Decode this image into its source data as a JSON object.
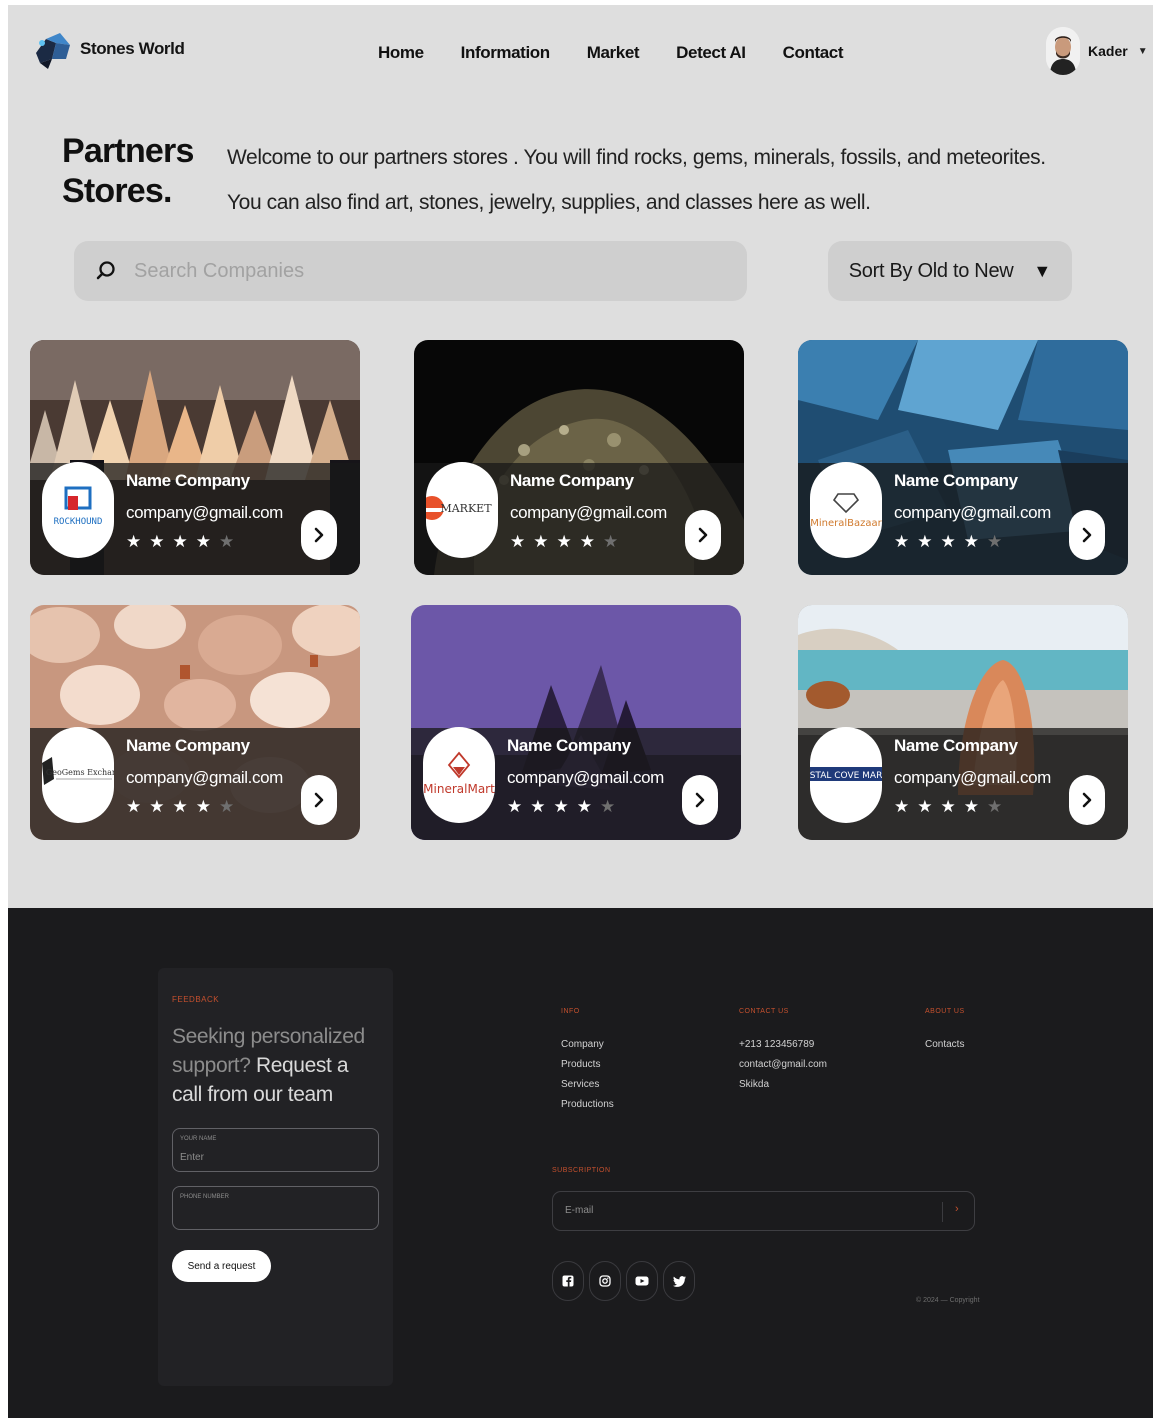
{
  "header": {
    "brand": "Stones World",
    "nav": [
      "Home",
      "Information",
      "Market",
      "Detect AI",
      "Contact"
    ],
    "user_name": "Kader"
  },
  "hero": {
    "title_line1": "Partners",
    "title_line2": "Stores.",
    "text": "Welcome to our partners stores . You will find rocks, gems, minerals, fossils, and meteorites. You can also find art, stones, jewelry, supplies, and classes here as well."
  },
  "search": {
    "placeholder": "Search Companies"
  },
  "sort": {
    "label": "Sort By Old to New"
  },
  "cards": [
    {
      "name": "Name Company",
      "email": "company@gmail.com",
      "rating": 4,
      "logo_text": "ROCKHOUND"
    },
    {
      "name": "Name Company",
      "email": "company@gmail.com",
      "rating": 4,
      "logo_text": "MARKET"
    },
    {
      "name": "Name Company",
      "email": "company@gmail.com",
      "rating": 4,
      "logo_text": "MineralBazaar"
    },
    {
      "name": "Name Company",
      "email": "company@gmail.com",
      "rating": 4,
      "logo_text": "GeoGems Exchang"
    },
    {
      "name": "Name Company",
      "email": "company@gmail.com",
      "rating": 4,
      "logo_text": "MineralMart"
    },
    {
      "name": "Name Company",
      "email": "company@gmail.com",
      "rating": 4,
      "logo_text": "STAL COVE MAR"
    }
  ],
  "footer": {
    "feedback": {
      "tag": "FEEDBACK",
      "headline_muted": "Seeking personalized support?",
      "headline_strong": "Request a call from our team",
      "name_label": "YOUR NAME",
      "name_placeholder": "Enter",
      "phone_label": "PHONE NUMBER",
      "button": "Send a request"
    },
    "info": {
      "title": "INFO",
      "items": [
        "Company",
        "Products",
        "Services",
        "Productions"
      ]
    },
    "contact": {
      "title": "CONTACT US",
      "items": [
        "+213 123456789",
        "contact@gmail.com",
        "Skikda"
      ]
    },
    "about": {
      "title": "ABOUT US",
      "items": [
        "Contacts"
      ]
    },
    "subscription": {
      "title": "SUBSCRIPTION",
      "placeholder": "E-mail"
    },
    "social": [
      "facebook-icon",
      "instagram-icon",
      "youtube-icon",
      "twitter-icon"
    ],
    "copyright": "© 2024 — Copyright"
  },
  "colors": {
    "accent": "#c4502e",
    "footer_bg": "#1b1b1d",
    "page_bg": "#dedede"
  }
}
